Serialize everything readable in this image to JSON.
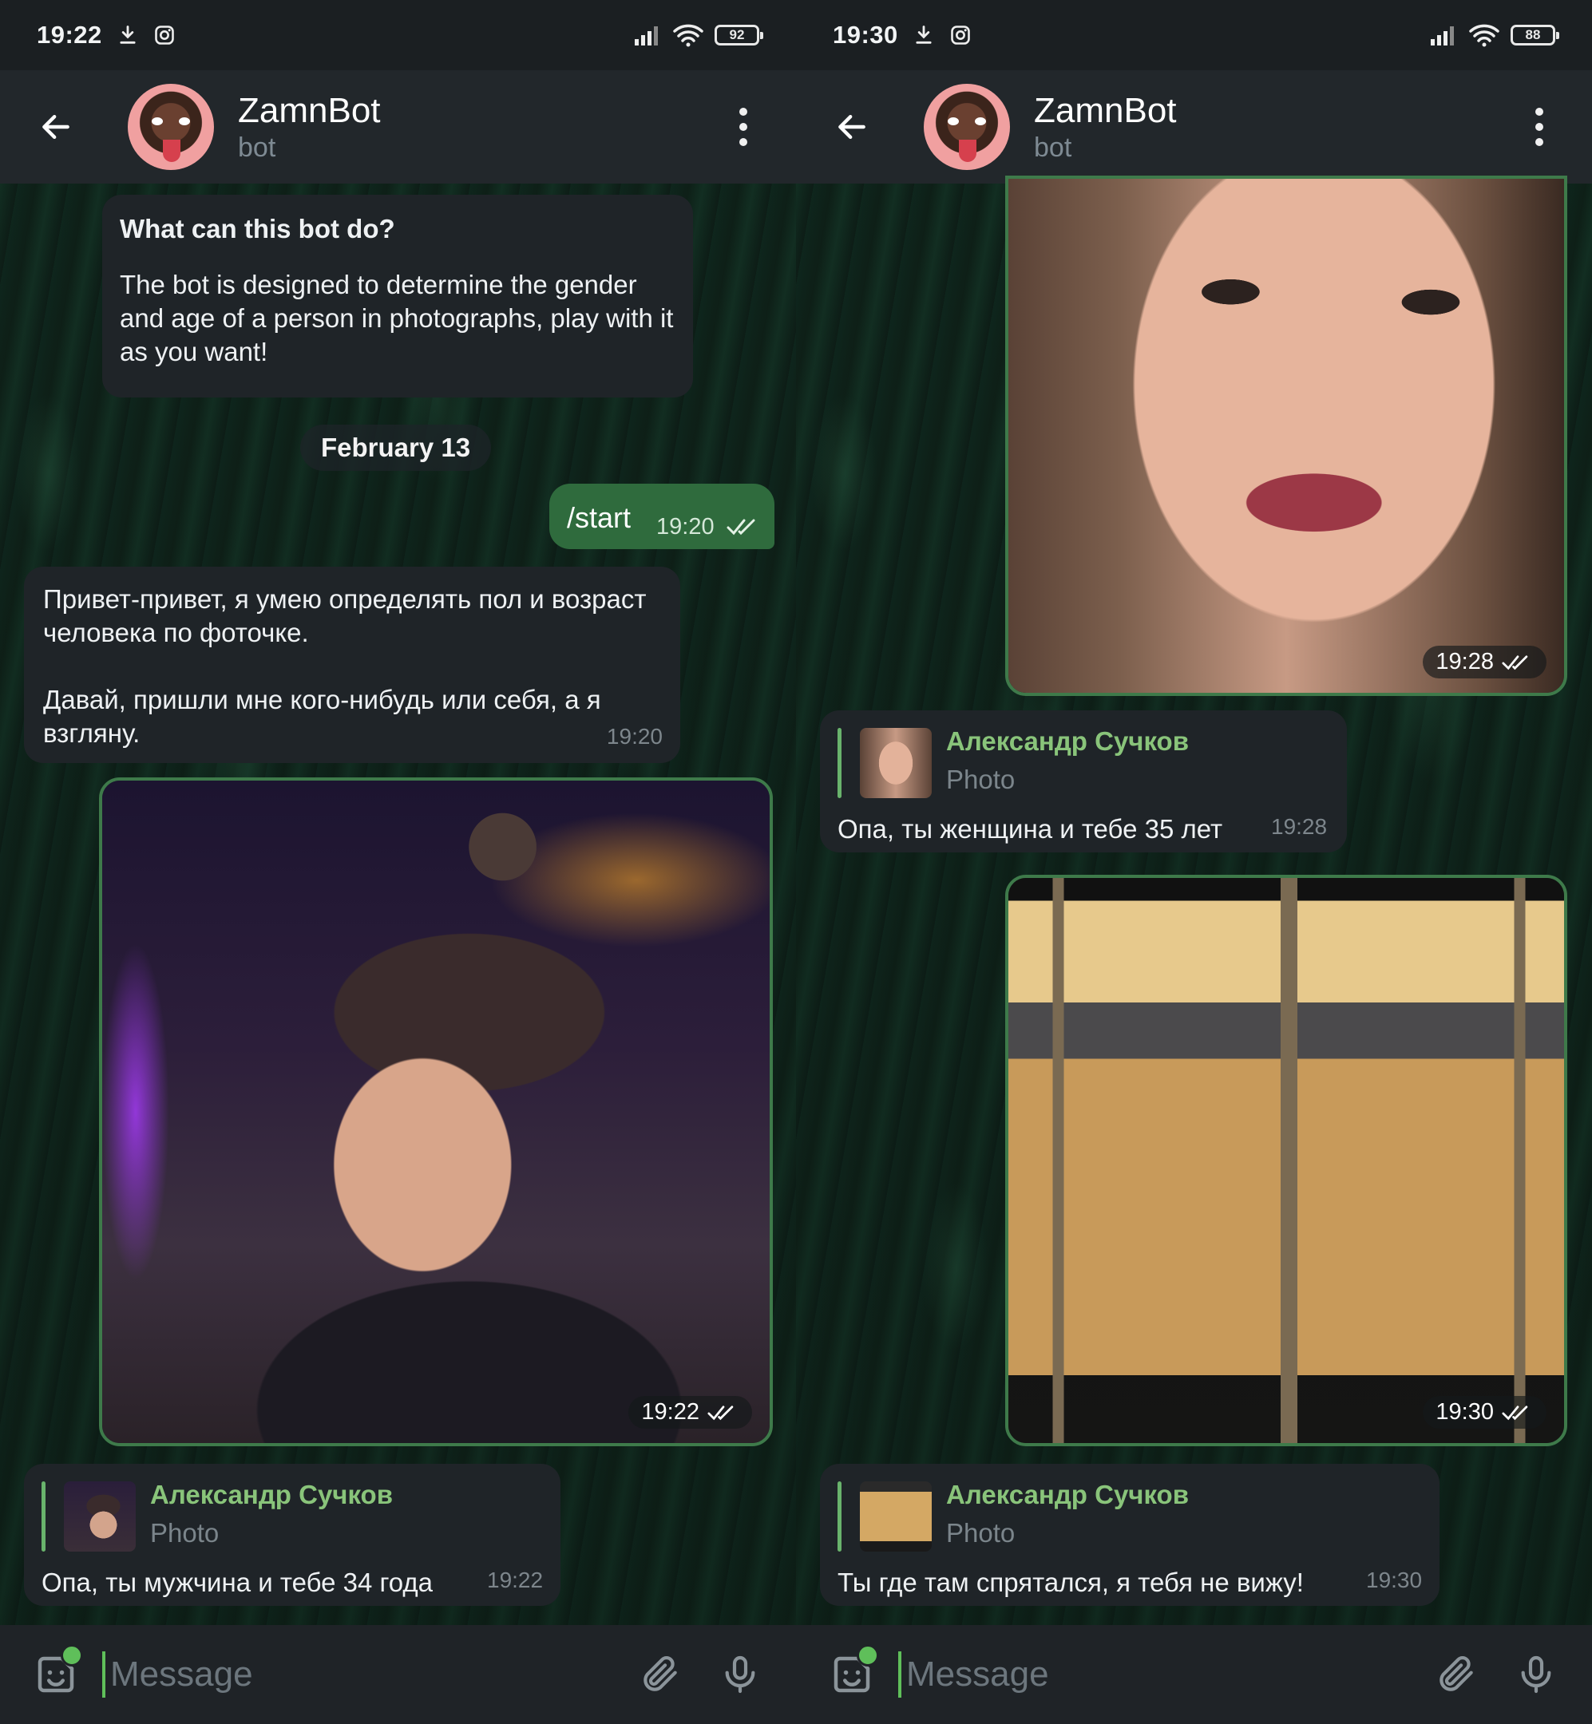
{
  "left": {
    "status": {
      "time": "19:22",
      "battery": "92"
    },
    "header": {
      "title": "ZamnBot",
      "subtitle": "bot"
    },
    "intro": {
      "heading": "What can this bot do?",
      "body": "The bot is designed to determine the gender and age of a person in photographs, play with it as you want!"
    },
    "date_divider": "February 13",
    "start_msg": {
      "text": "/start",
      "time": "19:20"
    },
    "greeting": {
      "line1": "Привет-привет, я умею определять пол и возраст человека по фоточке.",
      "line2": "Давай, пришли мне кого-нибудь или себя, а я взгляну.",
      "time": "19:20"
    },
    "photo_msg": {
      "time": "19:22"
    },
    "reply": {
      "name": "Александр Сучков",
      "type": "Photo",
      "text": "Опа, ты мужчина и тебе 34 года",
      "time": "19:22"
    },
    "input": {
      "placeholder": "Message"
    }
  },
  "right": {
    "status": {
      "time": "19:30",
      "battery": "88"
    },
    "header": {
      "title": "ZamnBot",
      "subtitle": "bot"
    },
    "photo1": {
      "time": "19:28"
    },
    "reply1": {
      "name": "Александр Сучков",
      "type": "Photo",
      "text": "Опа, ты женщина и тебе 35 лет",
      "time": "19:28"
    },
    "photo2": {
      "time": "19:30"
    },
    "reply2": {
      "name": "Александр Сучков",
      "type": "Photo",
      "text": "Ты где там спрятался, я тебя не вижу!",
      "time": "19:30"
    },
    "input": {
      "placeholder": "Message"
    }
  },
  "icons": {
    "back": "arrow-left-icon",
    "menu": "more-vertical-icon",
    "read": "double-check-icon",
    "emoji": "sticker-icon",
    "attach": "paperclip-icon",
    "mic": "microphone-icon",
    "download": "download-icon",
    "instagram": "instagram-icon",
    "signal": "signal-icon",
    "wifi": "wifi-icon"
  },
  "colors": {
    "accent": "#5fbf5a",
    "outgoing_bubble": "#2f6b3d",
    "incoming_bubble": "#1f2428",
    "reply_name": "#89c47a"
  }
}
